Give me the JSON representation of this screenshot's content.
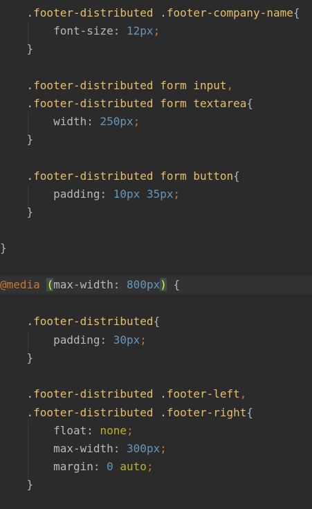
{
  "colors": {
    "background": "#2b2b2b",
    "selector": "#e8bf6a",
    "property": "#bababa",
    "number": "#6897bb",
    "keyword": "#bbb529",
    "punctuation": "#cc7832",
    "text": "#a9b7c6"
  },
  "code": {
    "l1": {
      "sel": ".footer-distributed .footer-company-name",
      "brace": "{"
    },
    "l2": {
      "prop": "font-size",
      "colon": ": ",
      "num": "12",
      "unit": "px",
      "semi": ";"
    },
    "l3": {
      "brace": "}"
    },
    "l5": {
      "sel": ".footer-distributed form input",
      "comma": ","
    },
    "l6": {
      "sel": ".footer-distributed form textarea",
      "brace": "{"
    },
    "l7": {
      "prop": "width",
      "colon": ": ",
      "num": "250",
      "unit": "px",
      "semi": ";"
    },
    "l8": {
      "brace": "}"
    },
    "l10": {
      "sel": ".footer-distributed form button",
      "brace": "{"
    },
    "l11": {
      "prop": "padding",
      "colon": ": ",
      "num1": "10",
      "unit1": "px",
      "space": " ",
      "num2": "35",
      "unit2": "px",
      "semi": ";"
    },
    "l12": {
      "brace": "}"
    },
    "l14": {
      "brace": "}"
    },
    "l16": {
      "at": "@media",
      "space": " ",
      "paren_open": "(",
      "prop": "max-width",
      "colon": ": ",
      "num": "800",
      "unit": "px",
      "paren_close": ")",
      "brace": " {"
    },
    "l18": {
      "sel": ".footer-distributed",
      "brace": "{"
    },
    "l19": {
      "prop": "padding",
      "colon": ": ",
      "num": "30",
      "unit": "px",
      "semi": ";"
    },
    "l20": {
      "brace": "}"
    },
    "l22": {
      "sel": ".footer-distributed .footer-left",
      "comma": ","
    },
    "l23": {
      "sel": ".footer-distributed .footer-right",
      "brace": "{"
    },
    "l24": {
      "prop": "float",
      "colon": ": ",
      "kw": "none",
      "semi": ";"
    },
    "l25": {
      "prop": "max-width",
      "colon": ": ",
      "num": "300",
      "unit": "px",
      "semi": ";"
    },
    "l26": {
      "prop": "margin",
      "colon": ": ",
      "num": "0",
      "space": " ",
      "kw": "auto",
      "semi": ";"
    },
    "l27": {
      "brace": "}"
    }
  }
}
